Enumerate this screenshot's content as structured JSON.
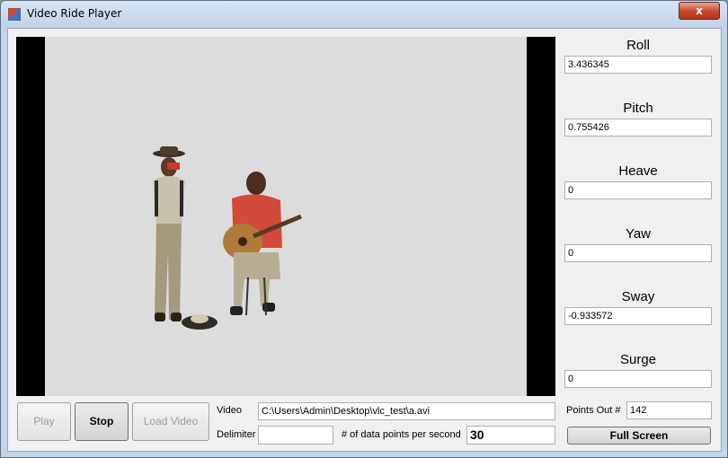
{
  "window": {
    "title": "Video Ride Player",
    "close_glyph": "x"
  },
  "readouts": [
    {
      "label": "Roll",
      "value": "3.436345"
    },
    {
      "label": "Pitch",
      "value": "0.755426"
    },
    {
      "label": "Heave",
      "value": "0"
    },
    {
      "label": "Yaw",
      "value": "0"
    },
    {
      "label": "Sway",
      "value": "-0.933572"
    },
    {
      "label": "Surge",
      "value": "0"
    }
  ],
  "controls": {
    "play_label": "Play",
    "stop_label": "Stop",
    "load_label": "Load Video",
    "video_label": "Video",
    "video_path": "C:\\Users\\Admin\\Desktop\\vlc_test\\a.avi",
    "delimiter_label": "Delimiter",
    "delimiter_value": "",
    "points_per_second_label": "# of data points per second",
    "points_per_second_value": "30",
    "points_out_label": "Points Out #",
    "points_out_value": "142",
    "fullscreen_label": "Full Screen"
  }
}
